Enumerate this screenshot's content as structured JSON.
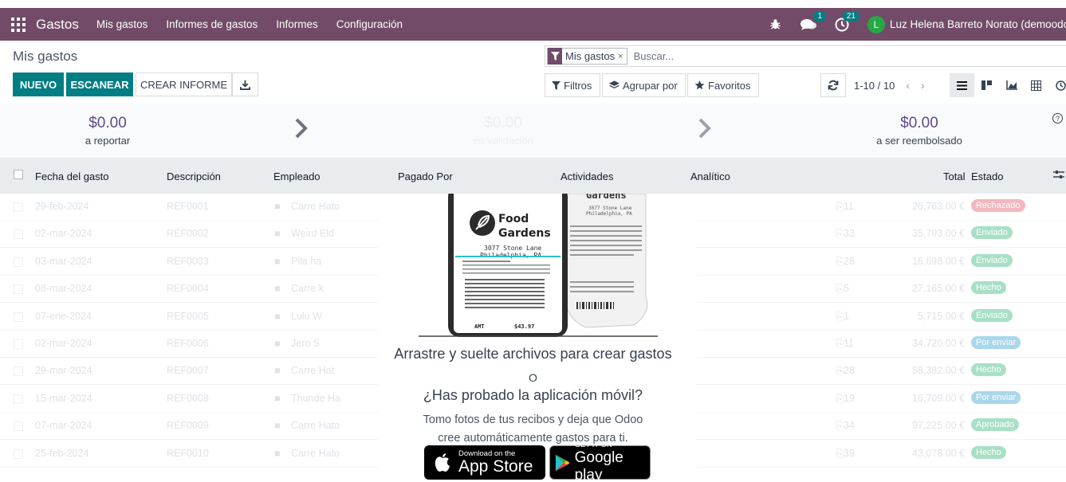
{
  "navbar": {
    "app_name": "Gastos",
    "menu": [
      "Mis gastos",
      "Informes de gastos",
      "Informes",
      "Configuración"
    ],
    "messages_badge": "1",
    "activities_badge": "21",
    "avatar_initial": "L",
    "user_name": "Luz Helena Barreto Norato (demoodoo",
    "color": "#714b67"
  },
  "control": {
    "title": "Mis gastos",
    "new_label": "NUEVO",
    "scan_label": "ESCANEAR",
    "report_label": "CREAR INFORME",
    "search_facet": "Mis gastos",
    "search_facet_close": "×",
    "search_placeholder": "Buscar...",
    "filters_label": "Filtros",
    "group_label": "Agrupar por",
    "favorites_label": "Favoritos",
    "pager_value": "1-10 / 10"
  },
  "summary": [
    {
      "amount": "$0.00",
      "label": "a reportar"
    },
    {
      "amount": "$0.00",
      "label": "en validación"
    },
    {
      "amount": "$0.00",
      "label": "a ser reembolsado"
    }
  ],
  "columns": [
    "Fecha del gasto",
    "Descripción",
    "Empleado",
    "Pagado Por",
    "Actividades",
    "Analítico",
    "Total",
    "Estado"
  ],
  "rows": [
    {
      "date": "29-feb-2024",
      "ref": "REF0001",
      "emp": "Carre Hato",
      "att": "11",
      "total": "26,763.00 €",
      "state": "Rechazado",
      "color": "#f3b7bd"
    },
    {
      "date": "02-mar-2024",
      "ref": "REF0002",
      "emp": "Weird Eld",
      "att": "33",
      "total": "35,793.00 €",
      "state": "Enviado",
      "color": "#a8e0c5"
    },
    {
      "date": "03-mar-2024",
      "ref": "REF0003",
      "emp": "Pila ha",
      "att": "28",
      "total": "16,698.00 €",
      "state": "Enviado",
      "color": "#a8e0c5"
    },
    {
      "date": "08-mar-2024",
      "ref": "REF0004",
      "emp": "Carre k",
      "att": "5",
      "total": "27,165.00 €",
      "state": "Hecho",
      "color": "#a8e0c5"
    },
    {
      "date": "07-ene-2024",
      "ref": "REF0005",
      "emp": "Lulu W",
      "att": "1",
      "total": "5,715.00 €",
      "state": "Enviado",
      "color": "#a8e0c5"
    },
    {
      "date": "02-mar-2024",
      "ref": "REF0006",
      "emp": "Jero S",
      "att": "11",
      "total": "34,720.00 €",
      "state": "Por enviar",
      "color": "#a9d7ec"
    },
    {
      "date": "29-mar-2024",
      "ref": "REF0007",
      "emp": "Carre Hat",
      "att": "28",
      "total": "58,382.00 €",
      "state": "Hecho",
      "color": "#a8e0c5"
    },
    {
      "date": "15-mar-2024",
      "ref": "REF0008",
      "emp": "Thunde Ha",
      "att": "19",
      "total": "16,709.00 €",
      "state": "Por enviar",
      "color": "#a9d7ec"
    },
    {
      "date": "07-mar-2024",
      "ref": "REF0009",
      "emp": "Carre Hato",
      "att": "34",
      "total": "97,225.00 €",
      "state": "Aprobado",
      "color": "#a8e0c5"
    },
    {
      "date": "25-feb-2024",
      "ref": "REF0010",
      "emp": "Carre Hato",
      "att": "39",
      "total": "43,078.00 €",
      "state": "Hecho",
      "color": "#a8e0c5"
    }
  ],
  "helper": {
    "receipt_brand_1": "Food",
    "receipt_brand_2": "Gardens",
    "receipt_address": "3077 Stone Lane",
    "receipt_city": "Philadelphia, PA",
    "receipt_amount_label": "AMT",
    "receipt_amount": "$43.97",
    "drop_text": "Arrastre y suelte archivos para crear gastos",
    "or_text": "O",
    "mobile_question": "¿Has probado la aplicación móvil?",
    "mobile_line1": "Tomo fotos de tus recibos y deja que Odoo",
    "mobile_line2": "cree automáticamente gastos para ti.",
    "appstore_small": "Download on the",
    "appstore_big": "App Store",
    "googleplay_small": "GET IT ON",
    "googleplay_big": "Google play"
  }
}
